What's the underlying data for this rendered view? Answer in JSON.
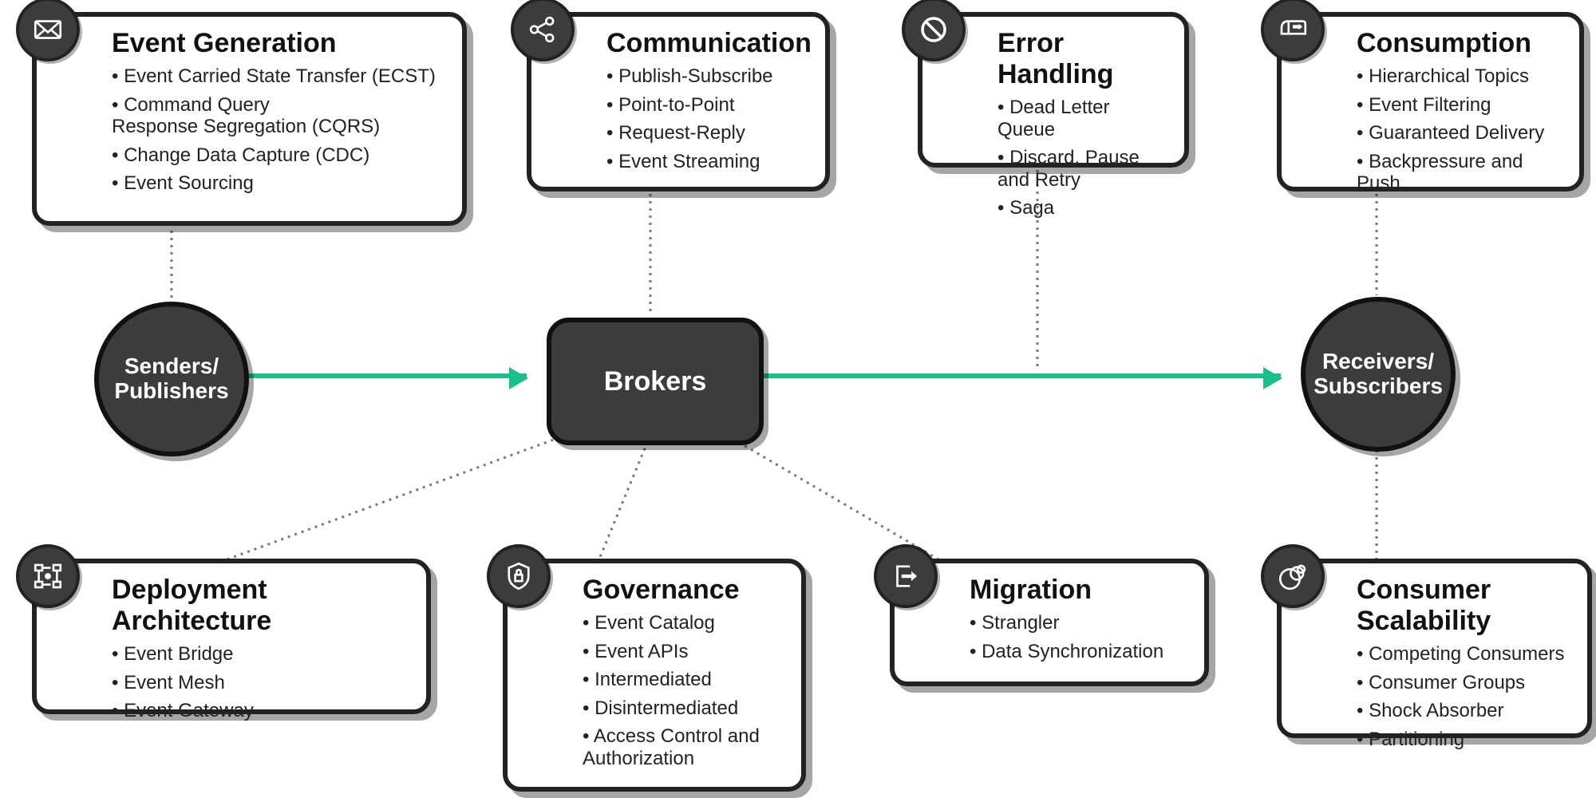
{
  "core": {
    "senders": "Senders/\nPublishers",
    "brokers": "Brokers",
    "receivers": "Receivers/\nSubscribers"
  },
  "cards": {
    "eventGeneration": {
      "title": "Event Generation",
      "items": [
        "Event Carried State Transfer (ECST)",
        "Command Query\nResponse Segregation (CQRS)",
        "Change Data Capture (CDC)",
        "Event Sourcing"
      ]
    },
    "communication": {
      "title": "Communication",
      "items": [
        "Publish-Subscribe",
        "Point-to-Point",
        "Request-Reply",
        "Event Streaming"
      ]
    },
    "errorHandling": {
      "title": "Error Handling",
      "items": [
        "Dead Letter Queue",
        "Discard, Pause\nand Retry",
        "Saga"
      ]
    },
    "consumption": {
      "title": "Consumption",
      "items": [
        "Hierarchical Topics",
        "Event Filtering",
        "Guaranteed Delivery",
        "Backpressure and Push"
      ]
    },
    "deployment": {
      "title": "Deployment Architecture",
      "items": [
        "Event Bridge",
        "Event Mesh",
        "Event Gateway"
      ]
    },
    "governance": {
      "title": "Governance",
      "items": [
        "Event Catalog",
        "Event APIs",
        "Intermediated",
        "Disintermediated",
        "Access Control and\nAuthorization"
      ]
    },
    "migration": {
      "title": "Migration",
      "items": [
        "Strangler",
        "Data Synchronization"
      ]
    },
    "scalability": {
      "title": "Consumer Scalability",
      "items": [
        "Competing Consumers",
        "Consumer Groups",
        "Shock Absorber",
        "Partitioning"
      ]
    }
  }
}
